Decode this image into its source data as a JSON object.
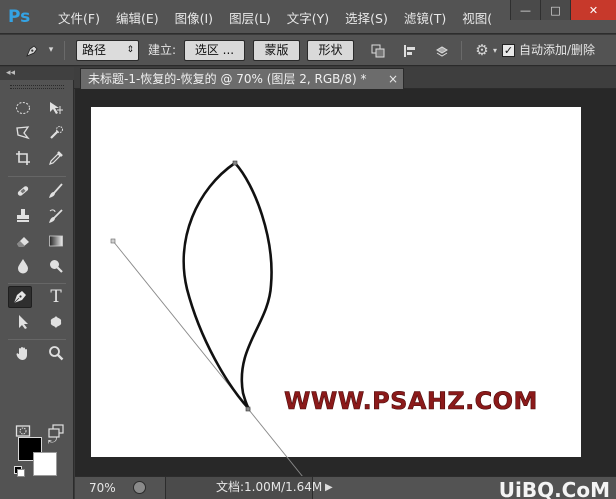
{
  "app": {
    "logo": "Ps"
  },
  "menu": [
    "文件(F)",
    "编辑(E)",
    "图像(I)",
    "图层(L)",
    "文字(Y)",
    "选择(S)",
    "滤镜(T)",
    "视图("
  ],
  "window_controls": {
    "minimize": "—",
    "maximize": "□",
    "close": "✕"
  },
  "options": {
    "tool_icon": "pen-icon",
    "mode_dropdown": "路径",
    "make_label": "建立:",
    "selection_button": "选区 ...",
    "mask_button": "蒙版",
    "shape_button": "形状",
    "auto_add_delete_checked": true,
    "auto_add_delete_label": "自动添加/删除"
  },
  "document_tab": {
    "title": "未标题-1-恢复的-恢复的 @ 70% (图层 2, RGB/8) *",
    "close": "×"
  },
  "tool_panel": {
    "collapse": "◂◂"
  },
  "canvas": {
    "watermark_text": "WWW.PSAHZ.COM",
    "watermark_color": "#8b1a1a"
  },
  "status": {
    "zoom": "70%",
    "doc_size": "文档:1.00M/1.64M",
    "play": "▶",
    "corner_brand": "UiBQ.CoM"
  }
}
